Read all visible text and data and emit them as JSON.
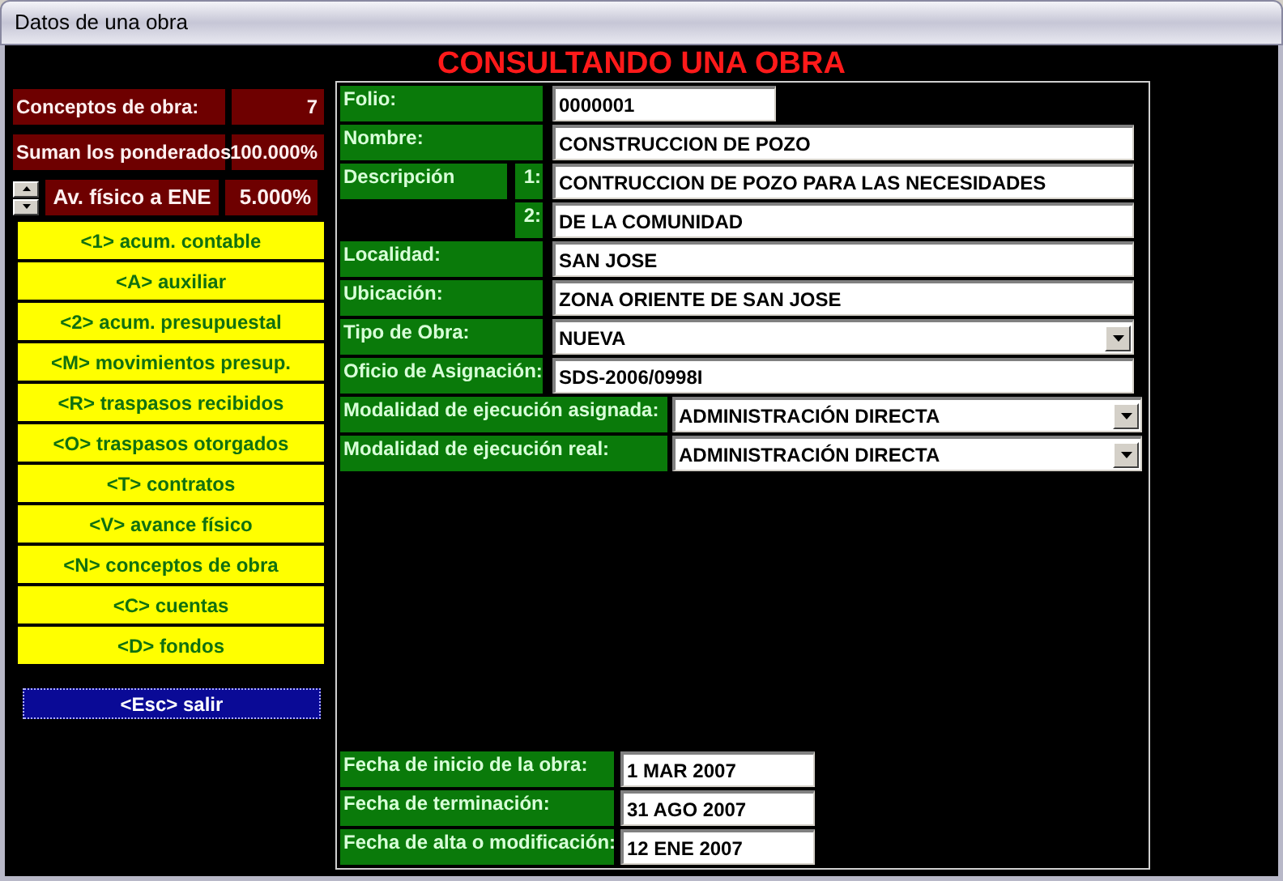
{
  "window": {
    "title": "Datos de una obra"
  },
  "header": "CONSULTANDO UNA OBRA",
  "summary": [
    {
      "label": "Conceptos de obra:",
      "value": "7"
    },
    {
      "label": "Suman los ponderados",
      "value": "100.000%"
    }
  ],
  "progress": {
    "label": "Av. físico a ENE",
    "value": "5.000%"
  },
  "menu": [
    "<1> acum. contable",
    "<A> auxiliar",
    "<2> acum. presupuestal",
    "<M> movimientos presup.",
    "<R> traspasos recibidos",
    "<O> traspasos otorgados",
    "<T> contratos",
    "<V> avance físico",
    "<N> conceptos de obra",
    "<C> cuentas",
    "<D> fondos"
  ],
  "exit_button": "<Esc> salir",
  "fields": [
    {
      "kind": "short",
      "label": "Folio:",
      "value": "0000001"
    },
    {
      "kind": "text",
      "label": "Nombre:",
      "value": "CONSTRUCCION DE POZO"
    },
    {
      "kind": "description",
      "label": "Descripción",
      "lines": [
        {
          "number": "1:",
          "value": "CONTRUCCION DE POZO PARA LAS NECESIDADES"
        },
        {
          "number": "2:",
          "value": "DE LA COMUNIDAD"
        }
      ]
    },
    {
      "kind": "text",
      "label": "Localidad:",
      "value": "SAN JOSE"
    },
    {
      "kind": "text",
      "label": "Ubicación:",
      "value": "ZONA ORIENTE DE SAN JOSE"
    },
    {
      "kind": "select",
      "label": "Tipo de Obra:",
      "value": "NUEVA"
    },
    {
      "kind": "text",
      "label": "Oficio de Asignación:",
      "value": "SDS-2006/0998I"
    }
  ],
  "modalidades": [
    {
      "label": "Modalidad de ejecución asignada:",
      "value": "ADMINISTRACIÓN DIRECTA"
    },
    {
      "label": "Modalidad de ejecución real:",
      "value": "ADMINISTRACIÓN DIRECTA"
    }
  ],
  "dates": [
    {
      "label": "Fecha de inicio de la obra:",
      "value": "1 MAR 2007"
    },
    {
      "label": "Fecha de terminación:",
      "value": "31 AGO 2007"
    },
    {
      "label": "Fecha de alta o modificación:",
      "value": "12 ENE 2007"
    }
  ]
}
